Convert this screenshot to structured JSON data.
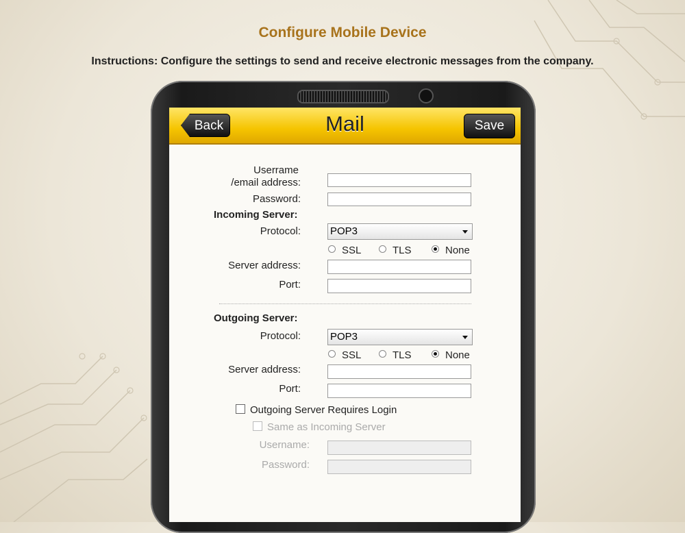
{
  "header": {
    "title": "Configure Mobile Device",
    "instructions": "Instructions: Configure the settings to send and receive electronic messages from the company."
  },
  "app": {
    "title": "Mail",
    "back_label": "Back",
    "save_label": "Save"
  },
  "account": {
    "username_label_line1": "Userrame",
    "username_label_line2": "/email address:",
    "username_value": "",
    "password_label": "Password:",
    "password_value": ""
  },
  "incoming": {
    "section_label": "Incoming Server:",
    "protocol_label": "Protocol:",
    "protocol_value": "POP3",
    "ssl_label": "SSL",
    "tls_label": "TLS",
    "none_label": "None",
    "security_selected": "None",
    "server_address_label": "Server address:",
    "server_address_value": "",
    "port_label": "Port:",
    "port_value": ""
  },
  "outgoing": {
    "section_label": "Outgoing Server:",
    "protocol_label": "Protocol:",
    "protocol_value": "POP3",
    "ssl_label": "SSL",
    "tls_label": "TLS",
    "none_label": "None",
    "security_selected": "None",
    "server_address_label": "Server address:",
    "server_address_value": "",
    "port_label": "Port:",
    "port_value": "",
    "requires_login_label": "Outgoing Server Requires Login",
    "requires_login_checked": false,
    "same_as_incoming_label": "Same as Incoming Server",
    "same_as_incoming_checked": false,
    "username_label": "Username:",
    "password_label": "Password:"
  },
  "colors": {
    "title": "#a8731c",
    "topbar": "#f5c400"
  }
}
